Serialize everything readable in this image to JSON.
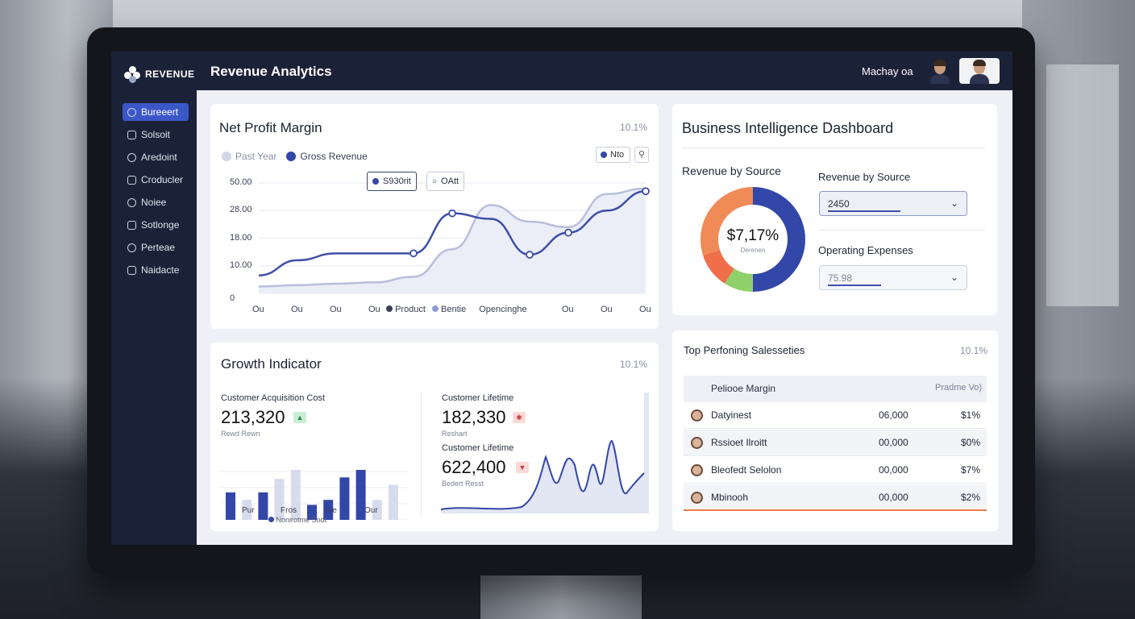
{
  "app": {
    "logo_text": "REVENUE",
    "header_title": "Revenue Analytics",
    "user_name": "Machay oa"
  },
  "sidebar": {
    "items": [
      {
        "label": "Bureeert",
        "icon": "dashboard-icon",
        "active": true
      },
      {
        "label": "Solsoit",
        "icon": "edit-icon"
      },
      {
        "label": "Aredoint",
        "icon": "report-icon"
      },
      {
        "label": "Croducler",
        "icon": "product-icon"
      },
      {
        "label": "Noiee",
        "icon": "analytics-icon"
      },
      {
        "label": "Sotlonge",
        "icon": "pen-icon"
      },
      {
        "label": "Perteae",
        "icon": "document-icon"
      },
      {
        "label": "Naidacte",
        "icon": "minus-circle-icon"
      }
    ]
  },
  "net_profit": {
    "title": "Net Profit Margin",
    "pct": "10.1%",
    "legend_past": "Past Year",
    "legend_gross": "Gross Revenue",
    "select_value": "Nto",
    "search_icon": "search-icon",
    "chip_primary": "S930rit",
    "chip_secondary": "OAtt",
    "legend_product": "Product",
    "legend_bentie": "Bentie",
    "legend_opening": "Opencinghe"
  },
  "chart_data": {
    "type": "line",
    "x": [
      "Ou",
      "Ou",
      "Ou",
      "Ou",
      "",
      "",
      "",
      "",
      "Ou",
      "Ou",
      "Ou"
    ],
    "ytick_labels": [
      "0",
      "10.00",
      "18.00",
      "28.00",
      "50.00"
    ],
    "ylim": [
      0,
      40
    ],
    "series": [
      {
        "name": "Gross Revenue",
        "values": [
          6.5,
          12,
          14.5,
          14.5,
          14.5,
          29,
          27,
          14,
          22,
          30,
          37
        ]
      },
      {
        "name": "Past Year",
        "values": [
          2.5,
          3,
          3.5,
          4,
          6,
          16,
          32,
          26,
          24,
          36,
          38
        ]
      }
    ],
    "grid": true
  },
  "bi": {
    "title": "Business Intelligence Dashboard",
    "revenue_by_source_label": "Revenue by Source",
    "donut_value": "$7,17%",
    "donut_caption": "Derenen",
    "donut_segments": [
      {
        "label": "blue",
        "value": 50,
        "color": "#3347a8"
      },
      {
        "label": "green",
        "value": 9,
        "color": "#8fd06a"
      },
      {
        "label": "red",
        "value": 11,
        "color": "#ef6f4a"
      },
      {
        "label": "orange",
        "value": 30,
        "color": "#f08a56"
      }
    ],
    "dropdown1_label": "Revenue by Source",
    "dropdown1_value": "2450",
    "dropdown1_progress": 0.55,
    "dropdown2_label": "Operating Expenses",
    "dropdown2_value": "75.98",
    "dropdown2_progress": 0.4
  },
  "growth": {
    "title": "Growth Indicator",
    "pct": "10.1%",
    "kpi1_label": "Customer Acquisition Cost",
    "kpi1_value": "213,320",
    "kpi1_sub": "Rewd Rewn",
    "kpi2_label": "Customer Lifetime",
    "kpi2_value": "182,330",
    "kpi2_sub": "Reshart",
    "kpi3_label": "Customer Lifetime",
    "kpi3_value": "622,400",
    "kpi3_sub": "Bedert Resst",
    "bar_x_labels": [
      "Pur",
      "Fros",
      "Ioe",
      "Our"
    ],
    "bar_legend": "Nonirotme Sodt",
    "bar_values": [
      {
        "v": 0.55,
        "dark": true
      },
      {
        "v": 0.4,
        "dark": false
      },
      {
        "v": 0.55,
        "dark": true
      },
      {
        "v": 0.82,
        "dark": false
      },
      {
        "v": 1.0,
        "dark": false
      },
      {
        "v": 0.3,
        "dark": true
      },
      {
        "v": 0.4,
        "dark": true
      },
      {
        "v": 0.85,
        "dark": true
      },
      {
        "v": 1.0,
        "dark": true
      },
      {
        "v": 0.4,
        "dark": false
      },
      {
        "v": 0.7,
        "dark": false
      }
    ]
  },
  "sales": {
    "title": "Top Perfoning Salesseties",
    "pct": "10.1%",
    "col1": "Peliooe Margin",
    "col3": "Pradme Vo)",
    "rows": [
      {
        "name": "Datyinest",
        "amount": "06,000",
        "pct": "$1%"
      },
      {
        "name": "Rssioet Ilroitt",
        "amount": "00,000",
        "pct": "$0%"
      },
      {
        "name": "Bleofedt Selolon",
        "amount": "00,000",
        "pct": "$7%"
      },
      {
        "name": "Mbinooh",
        "amount": "00,000",
        "pct": "$2%"
      }
    ]
  }
}
